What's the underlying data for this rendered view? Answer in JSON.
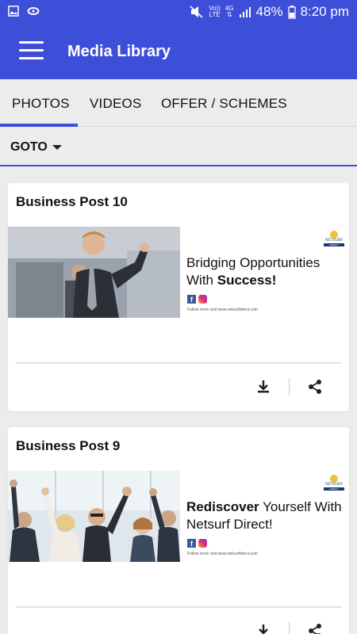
{
  "status_bar": {
    "volte_top": "Vo))",
    "volte_bottom": "LTE",
    "network": "4G",
    "battery": "48%",
    "time": "8:20 pm"
  },
  "app_bar": {
    "title": "Media Library"
  },
  "tabs": [
    {
      "label": "PHOTOS",
      "selected": true
    },
    {
      "label": "VIDEOS",
      "selected": false
    },
    {
      "label": "OFFER / SCHEMES",
      "selected": false
    }
  ],
  "goto": {
    "label": "GOTO"
  },
  "colors": {
    "primary": "#3d4ed8",
    "background": "#ececec"
  },
  "posts": [
    {
      "title": "Business Post 10",
      "headline_line1": "Bridging Opportunities",
      "headline_line2_prefix": "With ",
      "headline_line2_bold": "Success!",
      "footer": "Follow more visit www.netsurfdirect.com",
      "logo": "NETSURF",
      "logo_sub": "DIRECT"
    },
    {
      "title": "Business Post 9",
      "headline_bold": "Rediscover",
      "headline_line1_rest": " Yourself With",
      "headline_line2": "Netsurf Direct!",
      "footer": "Follow more visit www.netsurfdirect.com",
      "logo": "NETSURF",
      "logo_sub": "DIRECT"
    }
  ]
}
